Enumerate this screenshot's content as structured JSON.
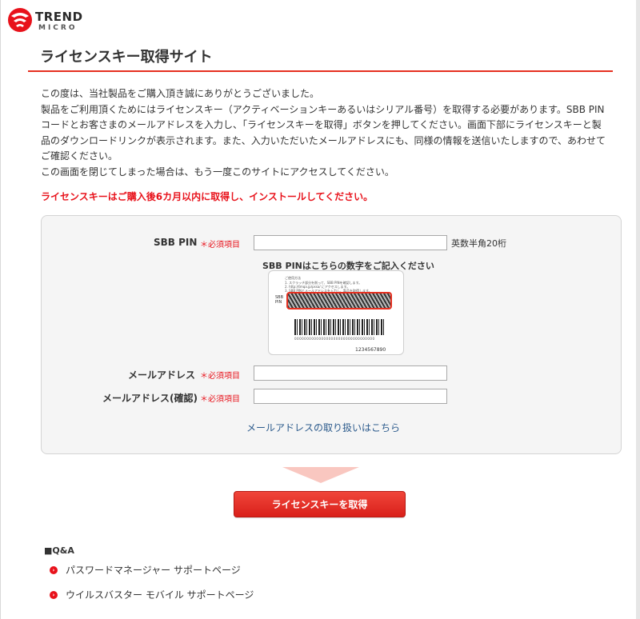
{
  "brand": {
    "line1": "TREND",
    "line2": "MICRO",
    "accent_color": "#e8121b"
  },
  "page": {
    "title": "ライセンスキー取得サイト"
  },
  "intro": {
    "p1": "この度は、当社製品をご購入頂き誠にありがとうございました。",
    "p2": "製品をご利用頂くためにはライセンスキー（アクティベーションキーあるいはシリアル番号）を取得する必要があります。SBB PINコードとお客さまのメールアドレスを入力し、「ライセンスキーを取得」ボタンを押してください。画面下部にライセンスキーと製品のダウンロードリンクが表示されます。また、入力いただいたメールアドレスにも、同様の情報を送信いたしますので、あわせてご確認ください。",
    "p3": "この画面を閉じてしまった場合は、もう一度このサイトにアクセスしてください。"
  },
  "warning": "ライセンスキーはご購入後6カ月以内に取得し、インストールしてください。",
  "form": {
    "pin_label": "SBB PIN",
    "required_mark": "＊必須項目",
    "pin_value": "",
    "pin_hint": "英数半角20桁",
    "card_caption": "SBB PINはこちらの数字をご記入ください",
    "card": {
      "heading": "ご使用方法",
      "step1": "1. スクラッチ部分を削って、SBB PINを確認します。",
      "step2": "2. http://tmqa.jp/pssa/ にアクセスします。",
      "step3": "3. SBB PINとメールアドレスを入力し、製品を取得します。",
      "pin_label_line1": "SBB",
      "pin_label_line2": "PIN",
      "digits": "000000000000000000000000000000000",
      "serial": "1234567890"
    },
    "email_label": "メールアドレス",
    "email_value": "",
    "email_confirm_label": "メールアドレス(確認)",
    "email_confirm_value": "",
    "privacy_link": "メールアドレスの取り扱いはこちら"
  },
  "submit_label": "ライセンスキーを取得",
  "qa": {
    "title": "■Q&A",
    "items": [
      {
        "label": "パスワードマネージャー サポートページ"
      },
      {
        "label": "ウイルスバスター モバイル サポートページ"
      }
    ]
  }
}
